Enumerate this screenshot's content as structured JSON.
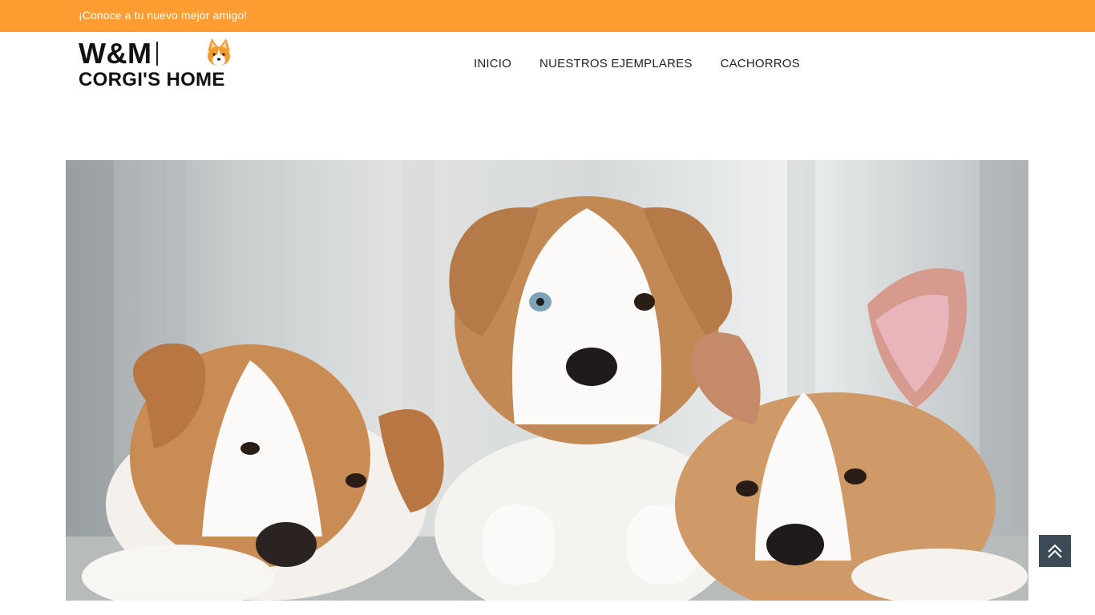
{
  "topbar": {
    "tagline": "¡Conoce a tu nuevo mejor amigo!",
    "background_color": "#ff9d32"
  },
  "logo": {
    "line1_left": "W&M",
    "line2": "CORGI'S HOME",
    "icon": "corgi-head-icon"
  },
  "nav": {
    "items": [
      {
        "label": "INICIO"
      },
      {
        "label": "NUESTROS EJEMPLARES"
      },
      {
        "label": "CACHORROS"
      }
    ]
  },
  "hero": {
    "image": "three-corgi-puppies-photo"
  },
  "scroll_top": {
    "icon": "double-chevron-up-icon",
    "background_color": "#3c4a57"
  }
}
